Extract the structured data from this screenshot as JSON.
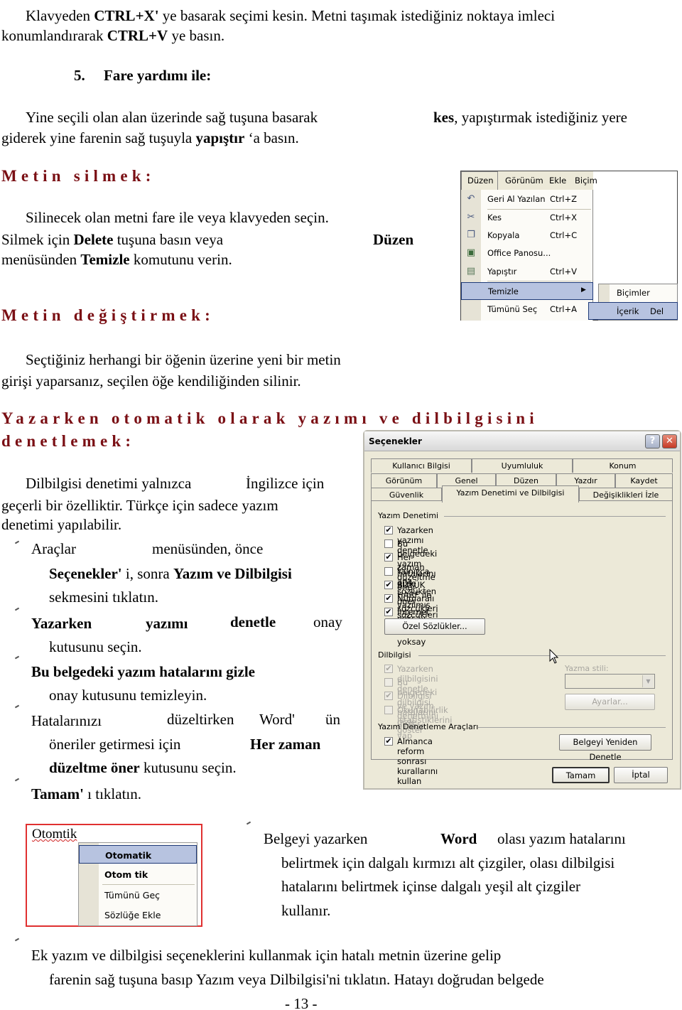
{
  "document": {
    "page_number": "- 13 -",
    "paragraphs": {
      "cut_paste": {
        "l1_a": "Klavyeden ",
        "l1_b": "CTRL+X'",
        "l1_c": " ye basarak seçimi kesin. Metni taşımak istediğiniz noktaya imleci",
        "l2_a": "konumlandırarak ",
        "l2_b": "CTRL+V",
        "l2_c": " ye basın."
      },
      "mouse_heading": {
        "num": "5.",
        "text": "Fare yardımı ile:"
      },
      "mouse": {
        "l1": "Yine seçili olan alan üzerinde sağ tuşuna basarak",
        "l1_right_b": "kes",
        "l1_right": ", yapıştırmak istediğiniz yere",
        "l2_a": "giderek yine farenin sağ tuşuyla ",
        "l2_b": "yapıştır",
        "l2_c": " ‘a basın."
      },
      "delete_heading": "Metin silmek:",
      "delete": {
        "l1": "Silinecek olan metni fare ile veya klavyeden seçin.",
        "l2_a": "Silmek için ",
        "l2_b": "Delete",
        "l2_c": " tuşuna basın veya",
        "l2_right_b": "Düzen",
        "l3_a": "menüsünden ",
        "l3_b": "Temizle",
        "l3_c": " komutunu verin."
      },
      "change_heading": "Metin değiştirmek:",
      "change": {
        "l1": "Seçtiğiniz herhangi bir öğenin üzerine yeni bir metin",
        "l2": "girişi yaparsanız, seçilen öğe kendiliğinden silinir."
      },
      "auto_heading_l1": "Yazarken otomatik olarak yazımı ve dilbilgisini",
      "auto_heading_l2": "denetlemek:",
      "grammar": {
        "l1_a": "Dilbilgisi denetimi yalnızca",
        "l1_b": "İngilizce için",
        "l2": "geçerli bir özelliktir. Türkçe için sadece yazım",
        "l3": "denetimi yapılabilir."
      },
      "steps": {
        "s1_a": "Araçlar",
        "s1_b": "menüsünden, önce",
        "s1_l2_a": "Seçenekler'",
        "s1_l2_b": " i, sonra ",
        "s1_l2_c": "Yazım ve Dilbilgisi",
        "s1_l3": "sekmesini tıklatın.",
        "s2_a": "Yazarken",
        "s2_b": "yazımı",
        "s2_c": "denetle",
        "s2_d": "onay",
        "s2_l2": "kutusunu seçin.",
        "s3_a": "Bu belgedeki yazım hatalarını gizle",
        "s3_l2": "onay kutusunu temizleyin.",
        "s4_a": "Hatalarınızı",
        "s4_b": "düzeltirken",
        "s4_c": "Word'",
        "s4_d": "ün",
        "s4_l2_a": "öneriler getirmesi için",
        "s4_l2_b": "Her zaman",
        "s4_l3_a": "düzeltme öner",
        "s4_l3_b": " kutusunu seçin.",
        "s5_a": "Tamam'",
        "s5_b": " ı tıklatın."
      },
      "underline": {
        "l1_a": "Belgeyi yazarken",
        "l1_b": "Word",
        "l1_c": "olası yazım hatalarını",
        "l2": "belirtmek için dalgalı kırmızı alt çizgiler, olası dilbilgisi",
        "l3": "hatalarını belirtmek içinse dalgalı yeşil alt çizgiler",
        "l4": "kullanır."
      },
      "extra": {
        "l1": "Ek yazım ve dilbilgisi seçeneklerini kullanmak için hatalı metnin üzerine gelip",
        "l2": "farenin sağ tuşuna basıp Yazım veya Dilbilgisi'ni tıklatın. Hatayı doğrudan belgede"
      }
    }
  },
  "edit_menu": {
    "menubar": [
      "Düzen",
      "Görünüm",
      "Ekle",
      "Biçim"
    ],
    "items": [
      {
        "label": "Geri Al Yazılan",
        "shortcut": "Ctrl+Z",
        "icon": "undo-icon"
      },
      {
        "label": "Kes",
        "shortcut": "Ctrl+X",
        "icon": "scissors-icon"
      },
      {
        "label": "Kopyala",
        "shortcut": "Ctrl+C",
        "icon": "copy-icon"
      },
      {
        "label": "Office Panosu...",
        "shortcut": "",
        "icon": "clipboard-icon"
      },
      {
        "label": "Yapıştır",
        "shortcut": "Ctrl+V",
        "icon": "paste-icon"
      },
      {
        "label": "Temizle",
        "shortcut": "",
        "icon": ""
      },
      {
        "label": "Tümünü Seç",
        "shortcut": "Ctrl+A",
        "icon": ""
      }
    ],
    "submenu": [
      {
        "label": "Biçimler",
        "shortcut": ""
      },
      {
        "label": "İçerik",
        "shortcut": "Del"
      }
    ]
  },
  "options_dialog": {
    "title": "Seçenekler",
    "help_label": "?",
    "close_label": "✕",
    "tabs_row1": [
      "Kullanıcı Bilgisi",
      "Uyumluluk",
      "Konum"
    ],
    "tabs_row2": [
      "Görünüm",
      "Genel",
      "Düzen",
      "Yazdır",
      "Kaydet"
    ],
    "tabs_row3": [
      "Güvenlik",
      "Yazım Denetimi ve Dilbilgisi",
      "Değişiklikleri İzle"
    ],
    "active_tab": "Yazım Denetimi ve Dilbilgisi",
    "spelling_group": "Yazım Denetimi",
    "spelling_options": [
      {
        "label": "Yazarken yazımı denetle",
        "checked": true
      },
      {
        "label": "Bu belgedeki yazım hatalarını gizle",
        "checked": false
      },
      {
        "label": "Her zaman düzeltme öner",
        "checked": true
      },
      {
        "label": "Yalnızca ana sözlükten öner",
        "checked": false
      },
      {
        "label": "BÜYÜK HARF ile yazılmış sözcükleri yoksay",
        "checked": true
      },
      {
        "label": "Numaralı sözcükleri yoksay",
        "checked": true
      },
      {
        "label": "Internet ve dosya adreslerini yoksay",
        "checked": true
      }
    ],
    "custom_dict_button": "Özel Sözlükler...",
    "grammar_group": "Dilbilgisi",
    "grammar_options": [
      {
        "label": "Yazarken dilbilgisini denetle",
        "checked": true
      },
      {
        "label": "Bu belgedeki dilbilgisi hatalarını gizle",
        "checked": false
      },
      {
        "label": "Dilbilgisi ve yazım denetmini birlikte yap",
        "checked": true
      },
      {
        "label": "Okunabilirlik istatistiklerini göster",
        "checked": false
      }
    ],
    "writing_style_label": "Yazma stili:",
    "writing_style_value": "",
    "settings_button": "Ayarlar...",
    "tools_group": "Yazım Denetleme Araçları",
    "tools_options": [
      {
        "label": "Almanca reform sonrası kurallarını kullan",
        "checked": true
      }
    ],
    "recheck_button": "Belgeyi Yeniden Denetle",
    "ok_button": "Tamam",
    "cancel_button": "İptal"
  },
  "context_menu": {
    "misspelled_word": "Otomtik",
    "items": [
      {
        "label": "Otomatik",
        "bold": true
      },
      {
        "label": "Otom tik",
        "bold": true
      },
      {
        "label": "Tümünü Geç",
        "bold": false
      },
      {
        "label": "Sözlüğe Ekle",
        "bold": false
      }
    ]
  }
}
